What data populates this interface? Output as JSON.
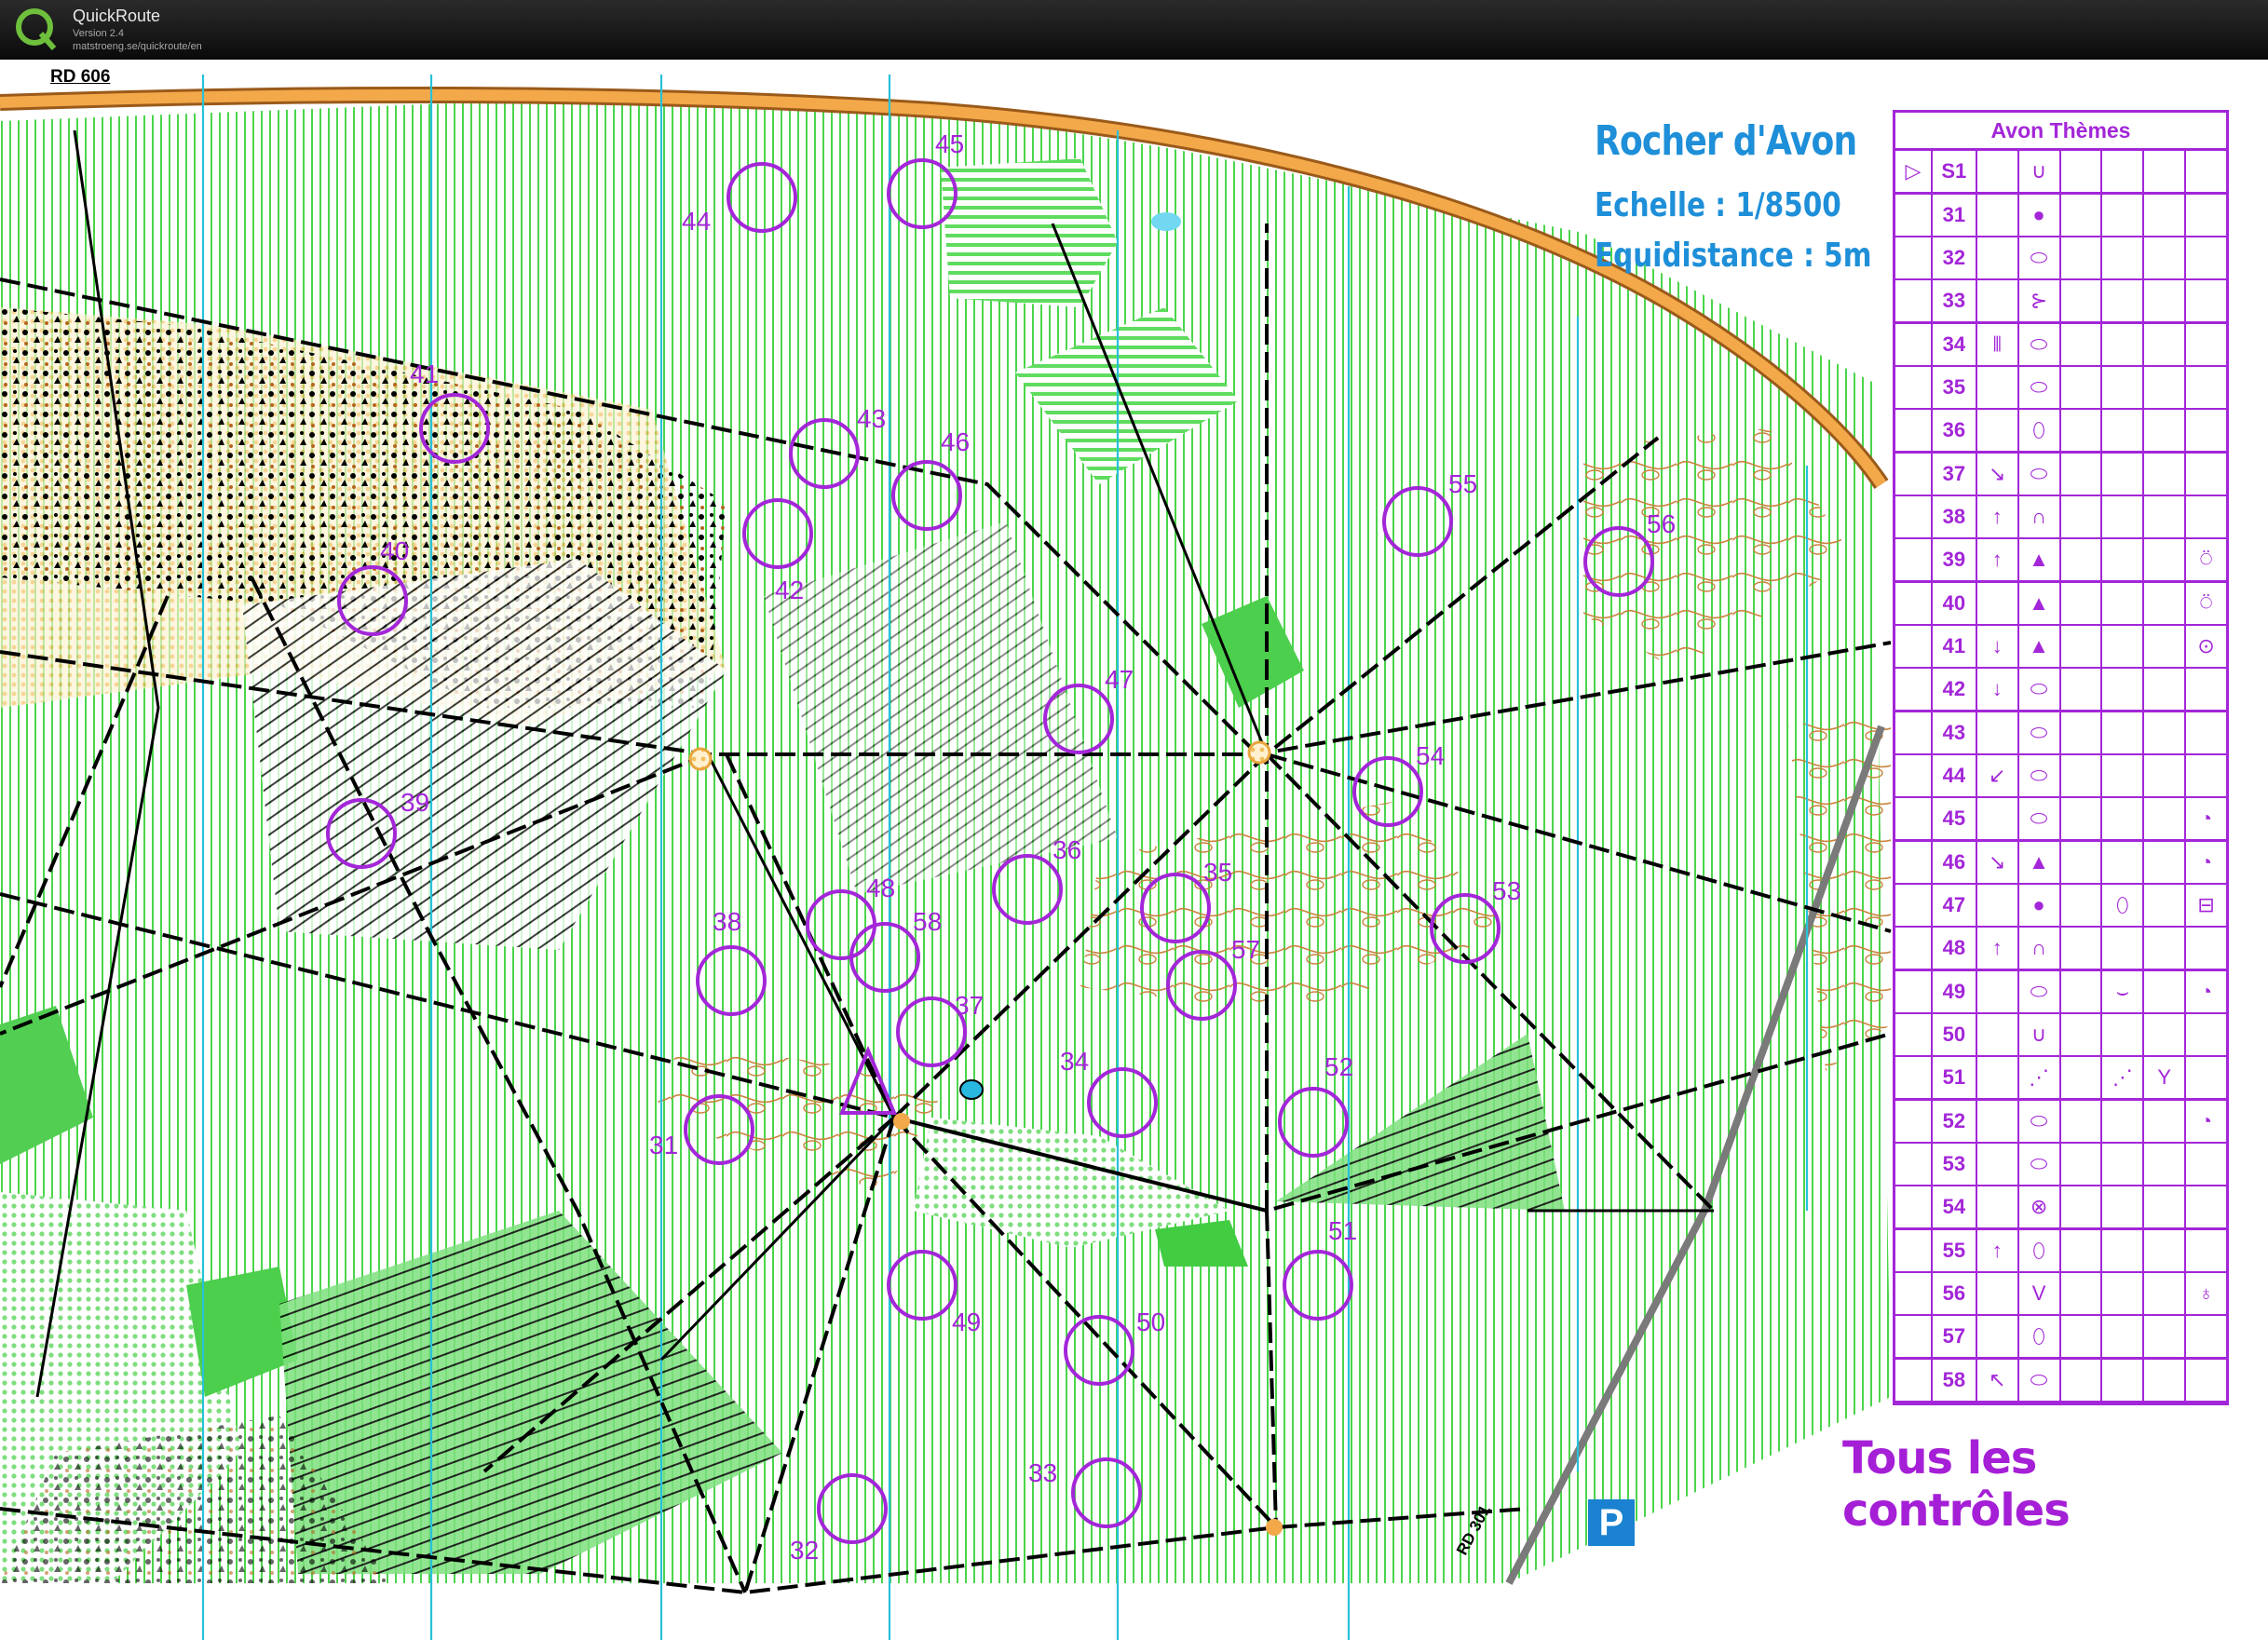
{
  "app": {
    "name": "QuickRoute",
    "version": "Version 2.4",
    "url": "matstroeng.se/quickroute/en"
  },
  "map": {
    "road_top": "RD 606",
    "road_bottom": "RD 301",
    "title": "Rocher d'Avon",
    "scale": "Echelle : 1/8500",
    "equidistance": "Equidistance : 5m",
    "all_controls": "Tous les contrôles",
    "parking": "P",
    "colors": {
      "course": "#a326d8",
      "title_blue": "#1e8fd8",
      "forest_green": "#3cc83c",
      "open_yellow": "#f7c96b",
      "contour_brown": "#b5651d",
      "road_orange": "#f2a33a"
    },
    "controls": [
      {
        "num": "31"
      },
      {
        "num": "32"
      },
      {
        "num": "33"
      },
      {
        "num": "34"
      },
      {
        "num": "35"
      },
      {
        "num": "36"
      },
      {
        "num": "37"
      },
      {
        "num": "38"
      },
      {
        "num": "39"
      },
      {
        "num": "40"
      },
      {
        "num": "41"
      },
      {
        "num": "42"
      },
      {
        "num": "43"
      },
      {
        "num": "44"
      },
      {
        "num": "45"
      },
      {
        "num": "46"
      },
      {
        "num": "47"
      },
      {
        "num": "48"
      },
      {
        "num": "49"
      },
      {
        "num": "50"
      },
      {
        "num": "51"
      },
      {
        "num": "52"
      },
      {
        "num": "53"
      },
      {
        "num": "54"
      },
      {
        "num": "55"
      },
      {
        "num": "56"
      },
      {
        "num": "57"
      },
      {
        "num": "58"
      }
    ]
  },
  "descriptions": {
    "title": "Avon Thèmes",
    "rows": [
      {
        "code": "S1",
        "dir": "",
        "feature": "∪",
        "extra": "",
        "pos": "",
        "start": true
      },
      {
        "code": "31",
        "dir": "",
        "feature": "●",
        "extra": "",
        "pos": ""
      },
      {
        "code": "32",
        "dir": "",
        "feature": "⬭",
        "extra": "",
        "pos": ""
      },
      {
        "code": "33",
        "dir": "",
        "feature": "⊱",
        "extra": "",
        "pos": ""
      },
      {
        "code": "34",
        "dir": "⫴",
        "feature": "⬭",
        "extra": "",
        "pos": ""
      },
      {
        "code": "35",
        "dir": "",
        "feature": "⬭",
        "extra": "",
        "pos": ""
      },
      {
        "code": "36",
        "dir": "",
        "feature": "⬯",
        "extra": "",
        "pos": ""
      },
      {
        "code": "37",
        "dir": "↘",
        "feature": "⬭",
        "extra": "",
        "pos": ""
      },
      {
        "code": "38",
        "dir": "↑",
        "feature": "∩",
        "extra": "",
        "pos": ""
      },
      {
        "code": "39",
        "dir": "↑",
        "feature": "▲",
        "extra": "",
        "pos": "⍥"
      },
      {
        "code": "40",
        "dir": "",
        "feature": "▲",
        "extra": "",
        "pos": "⍥"
      },
      {
        "code": "41",
        "dir": "↓",
        "feature": "▲",
        "extra": "",
        "pos": "⊙"
      },
      {
        "code": "42",
        "dir": "↓",
        "feature": "⬭",
        "extra": "",
        "pos": ""
      },
      {
        "code": "43",
        "dir": "",
        "feature": "⬭",
        "extra": "",
        "pos": ""
      },
      {
        "code": "44",
        "dir": "↙",
        "feature": "⬭",
        "extra": "",
        "pos": ""
      },
      {
        "code": "45",
        "dir": "",
        "feature": "⬭",
        "extra": "",
        "pos": "◔"
      },
      {
        "code": "46",
        "dir": "↘",
        "feature": "▲",
        "extra": "",
        "pos": "◔"
      },
      {
        "code": "47",
        "dir": "",
        "feature": "●",
        "extra": "⬯",
        "pos": "⊟"
      },
      {
        "code": "48",
        "dir": "↑",
        "feature": "∩",
        "extra": "",
        "pos": ""
      },
      {
        "code": "49",
        "dir": "",
        "feature": "⬭",
        "extra": "⌣",
        "pos": "◔"
      },
      {
        "code": "50",
        "dir": "",
        "feature": "∪",
        "extra": "",
        "pos": ""
      },
      {
        "code": "51",
        "dir": "",
        "feature": "⋰",
        "extra": "⋰",
        "pos": "",
        "pos2": "Y"
      },
      {
        "code": "52",
        "dir": "",
        "feature": "⬭",
        "extra": "",
        "pos": "◔"
      },
      {
        "code": "53",
        "dir": "",
        "feature": "⬭",
        "extra": "",
        "pos": ""
      },
      {
        "code": "54",
        "dir": "",
        "feature": "⊗",
        "extra": "",
        "pos": ""
      },
      {
        "code": "55",
        "dir": "↑",
        "feature": "⬯",
        "extra": "",
        "pos": ""
      },
      {
        "code": "56",
        "dir": "",
        "feature": "V",
        "extra": "",
        "pos": "♁"
      },
      {
        "code": "57",
        "dir": "",
        "feature": "⬯",
        "extra": "",
        "pos": ""
      },
      {
        "code": "58",
        "dir": "↖",
        "feature": "⬭",
        "extra": "",
        "pos": ""
      }
    ]
  }
}
